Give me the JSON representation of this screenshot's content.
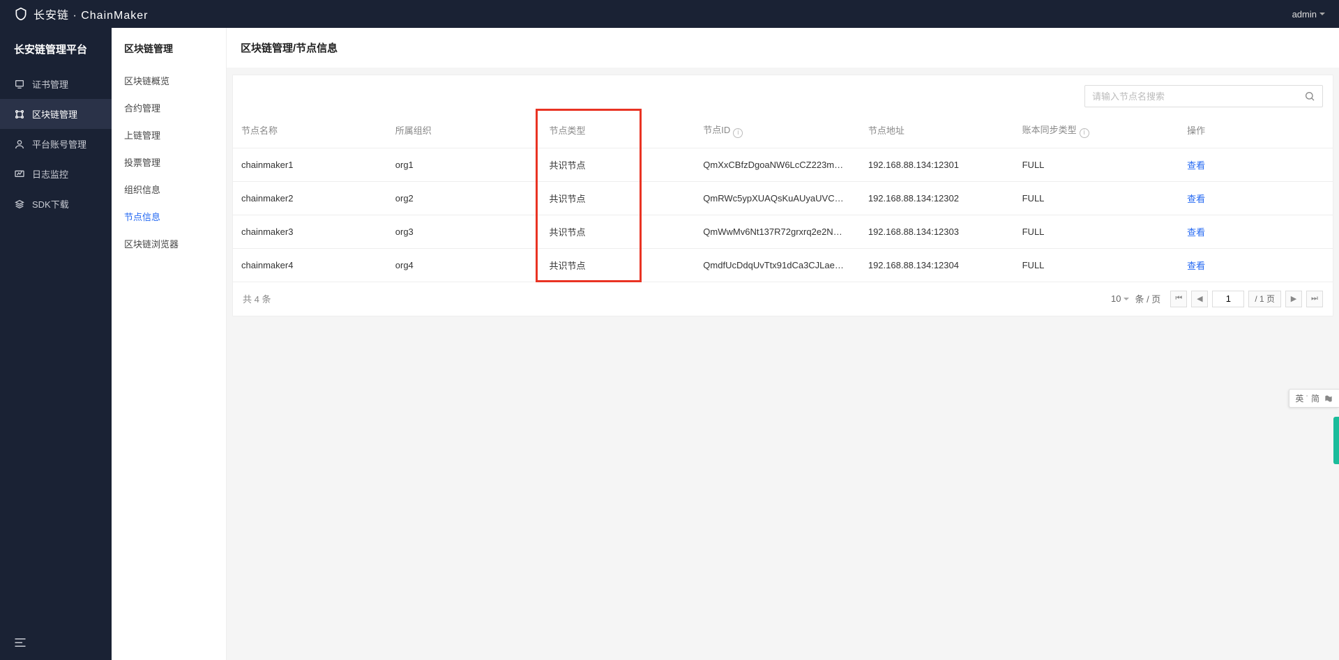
{
  "topbar": {
    "logo_text": "长安链 · ChainMaker",
    "user": "admin"
  },
  "sidebar_primary": {
    "title": "长安链管理平台",
    "items": [
      {
        "label": "证书管理",
        "icon": "cert-icon"
      },
      {
        "label": "区块链管理",
        "icon": "chain-icon",
        "active": true
      },
      {
        "label": "平台账号管理",
        "icon": "user-icon"
      },
      {
        "label": "日志监控",
        "icon": "monitor-icon"
      },
      {
        "label": "SDK下载",
        "icon": "download-icon"
      }
    ]
  },
  "sidebar_secondary": {
    "title": "区块链管理",
    "items": [
      {
        "label": "区块链概览"
      },
      {
        "label": "合约管理"
      },
      {
        "label": "上链管理"
      },
      {
        "label": "投票管理"
      },
      {
        "label": "组织信息"
      },
      {
        "label": "节点信息",
        "active": true
      },
      {
        "label": "区块链浏览器"
      }
    ]
  },
  "breadcrumb": "区块链管理/节点信息",
  "search": {
    "placeholder": "请输入节点名搜索"
  },
  "table": {
    "headers": [
      {
        "label": "节点名称"
      },
      {
        "label": "所属组织"
      },
      {
        "label": "节点类型",
        "highlight": true
      },
      {
        "label": "节点ID",
        "info": true
      },
      {
        "label": "节点地址"
      },
      {
        "label": "账本同步类型",
        "info": true
      },
      {
        "label": "操作"
      }
    ],
    "rows": [
      {
        "name": "chainmaker1",
        "org": "org1",
        "type": "共识节点",
        "id": "QmXxCBfzDgoaNW6LcCZ223m…",
        "addr": "192.168.88.134:12301",
        "sync": "FULL",
        "action": "查看"
      },
      {
        "name": "chainmaker2",
        "org": "org2",
        "type": "共识节点",
        "id": "QmRWc5ypXUAQsKuAUyaUVC…",
        "addr": "192.168.88.134:12302",
        "sync": "FULL",
        "action": "查看"
      },
      {
        "name": "chainmaker3",
        "org": "org3",
        "type": "共识节点",
        "id": "QmWwMv6Nt137R72grxrq2e2N…",
        "addr": "192.168.88.134:12303",
        "sync": "FULL",
        "action": "查看"
      },
      {
        "name": "chainmaker4",
        "org": "org4",
        "type": "共识节点",
        "id": "QmdfUcDdqUvTtx91dCa3CJLae…",
        "addr": "192.168.88.134:12304",
        "sync": "FULL",
        "action": "查看"
      }
    ]
  },
  "pagination": {
    "total_text": "共 4 条",
    "page_size": "10",
    "per_page_suffix": "条 / 页",
    "current_page": "1",
    "total_pages_label": "/ 1 页"
  },
  "ime": {
    "text": "英 ˙ 简"
  }
}
